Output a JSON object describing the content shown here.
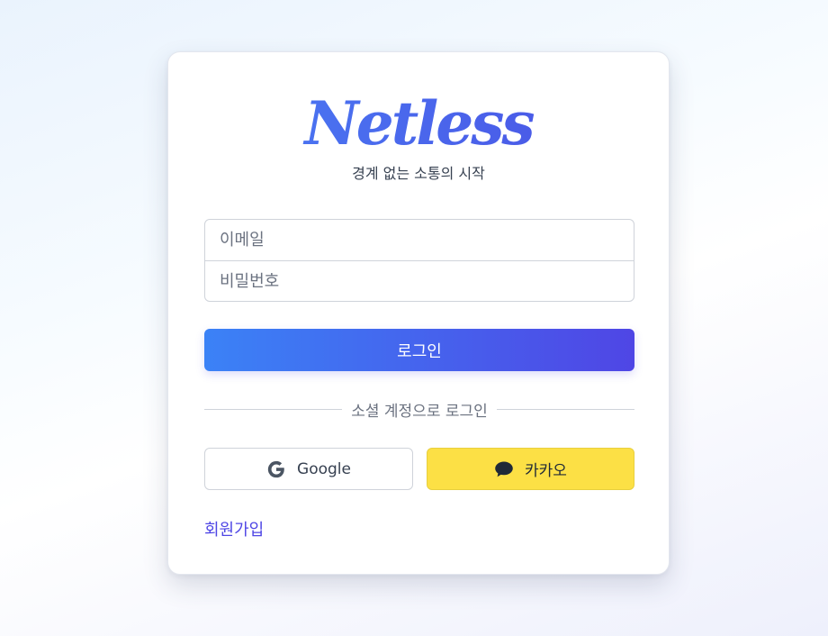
{
  "brand": {
    "logo_text": "Netless",
    "tagline": "경계 없는 소통의 시작",
    "logo_color": "#4f66ee"
  },
  "login_form": {
    "email_placeholder": "이메일",
    "password_placeholder": "비밀번호",
    "submit_label": "로그인"
  },
  "social_login": {
    "divider_label": "소셜 계정으로 로그인",
    "google_label": "Google",
    "google_icon": "google-g-icon",
    "kakao_label": "카카오",
    "kakao_icon": "chat-bubble-icon",
    "kakao_color": "#fce045"
  },
  "footer": {
    "signup_label": "회원가입"
  },
  "theme": {
    "primary_gradient_start": "#3b82f6",
    "primary_gradient_end": "#4f46e5"
  }
}
